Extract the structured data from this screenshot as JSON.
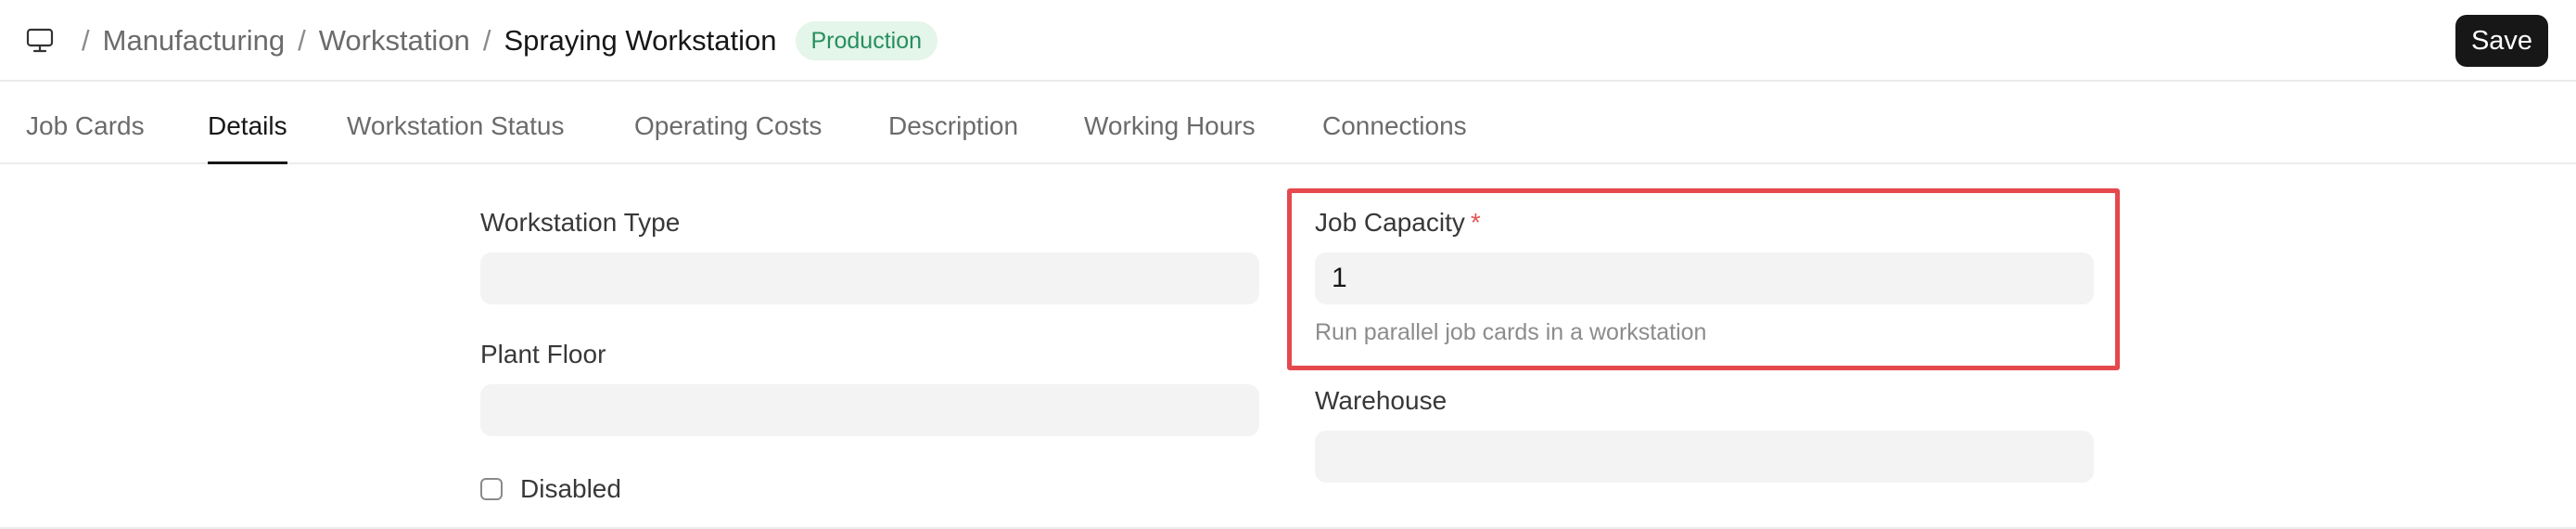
{
  "breadcrumb": {
    "icon": "monitor-icon",
    "items": [
      "Manufacturing",
      "Workstation"
    ],
    "current": "Spraying Workstation",
    "separator": "/"
  },
  "status_badge": "Production",
  "header": {
    "save_label": "Save"
  },
  "tabs": [
    {
      "label": "Job Cards"
    },
    {
      "label": "Details"
    },
    {
      "label": "Workstation Status"
    },
    {
      "label": "Operating Costs"
    },
    {
      "label": "Description"
    },
    {
      "label": "Working Hours"
    },
    {
      "label": "Connections"
    }
  ],
  "active_tab": "Details",
  "form": {
    "workstation_type": {
      "label": "Workstation Type",
      "value": ""
    },
    "plant_floor": {
      "label": "Plant Floor",
      "value": ""
    },
    "disabled": {
      "label": "Disabled",
      "checked": false
    },
    "job_capacity": {
      "label": "Job Capacity",
      "required_mark": "*",
      "value": "1",
      "help": "Run parallel job cards in a workstation"
    },
    "warehouse": {
      "label": "Warehouse",
      "value": ""
    }
  },
  "colors": {
    "accent": "#171717",
    "badge_bg": "#e4f5e9",
    "badge_text": "#278f5e",
    "highlight": "#e5484d",
    "required": "#e35555"
  }
}
